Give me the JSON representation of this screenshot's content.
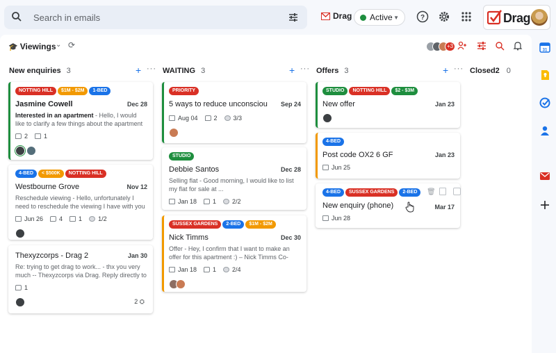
{
  "search": {
    "placeholder": "Search in emails",
    "icon": "search-icon",
    "filter_icon": "tune-icon"
  },
  "top": {
    "drag_label": "Drag",
    "status": "Active",
    "status_color": "#1e8e3e",
    "brand": "Drag",
    "icons": [
      "help-icon",
      "gear-icon",
      "apps-grid-icon"
    ]
  },
  "board": {
    "name": "Viewings",
    "more_count": "+3"
  },
  "columns": [
    {
      "name": "New enquiries",
      "count": "3"
    },
    {
      "name": "WAITING",
      "count": "3"
    },
    {
      "name": "Offers",
      "count": "3"
    },
    {
      "name": "Closed2",
      "count": "0"
    }
  ],
  "cards": {
    "c1": {
      "tags": [
        "NOTTING HILL",
        "$1M - $2M",
        "1-BED"
      ],
      "title": "Jasmine Cowell",
      "date": "Dec 28",
      "snippet_bold": "Interested in an apartment",
      "snippet": " - Hello, I would like to clarify a few things about the apartment ...",
      "comments": "2",
      "files": "1"
    },
    "c2": {
      "tags": [
        "4-BED",
        "< $500K",
        "NOTTING HILL"
      ],
      "title": "Westbourne Grove",
      "date": "Nov 12",
      "snippet": "Reschedule viewing - Hello, unfortunately I need to reschedule the viewing I have with you ...",
      "due": "Jun 26",
      "comments": "4",
      "files": "1",
      "tasks": "1/2"
    },
    "c3": {
      "title": "Thexyzcorps - Drag",
      "title_num": "2",
      "date": "Jan 30",
      "snippet": "Re: trying to get drag to work... - thx you very much -- Thexyzcorps via Drag. Reply directly to ...",
      "comments": "1",
      "assign": "2"
    },
    "c4": {
      "tags": [
        "PRIORITY"
      ],
      "title": "5 ways to reduce unconsciou",
      "date": "Sep 24",
      "due": "Aug 04",
      "comments": "2",
      "tasks": "3/3"
    },
    "c5": {
      "tags": [
        "STUDIO"
      ],
      "title": "Debbie Santos",
      "date": "Dec 28",
      "snippet": "Selling flat - Good morning, I would like to list my flat for sale at ...",
      "due": "Jan 18",
      "comments": "1",
      "tasks": "2/2"
    },
    "c6": {
      "tags": [
        "SUSSEX GARDENS",
        "2-BED",
        "$1M - $2M"
      ],
      "title": "Nick Timms",
      "date": "Dec 30",
      "snippet": "Offer - Hey, I confirm that I want to make an offer for this apartment :) – Nick Timms Co-Founder ...",
      "due": "Jan 18",
      "comments": "1",
      "tasks": "2/4"
    },
    "c7": {
      "tags": [
        "STUDIO",
        "NOTTING HILL",
        "$2 - $3M"
      ],
      "title": "New offer",
      "date": "Jan 23"
    },
    "c8": {
      "tags": [
        "4-BED"
      ],
      "title": "Post code OX2 6 GF",
      "date": "Jan 23",
      "due": "Jun 25"
    },
    "c9": {
      "tags": [
        "4-BED",
        "SUSSEX GARDENS",
        "2-BED"
      ],
      "title": "New enquiry (phone)",
      "date": "Mar 17",
      "due": "Jun 28"
    }
  },
  "sidebar_icons": [
    "calendar-icon",
    "keep-icon",
    "tasks-icon",
    "contacts-icon",
    "drag-icon",
    "add-icon"
  ]
}
